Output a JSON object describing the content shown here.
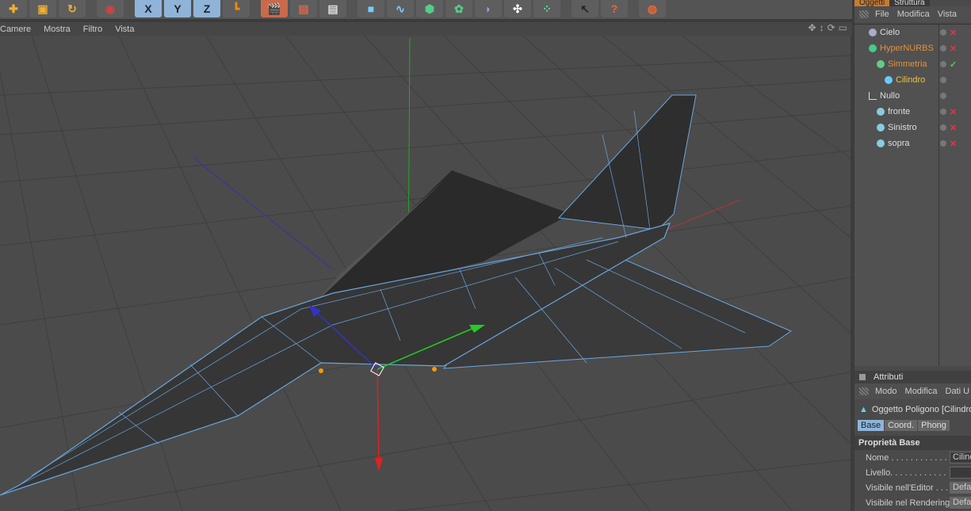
{
  "toolbar": {
    "buttons": [
      "move",
      "scale",
      "rotate",
      "live-select",
      "x-axis",
      "y-axis",
      "z-axis",
      "coord-system",
      "render-view",
      "render-picture-viewer",
      "edit-render-settings",
      "cube",
      "spline",
      "nurbs",
      "array",
      "deformer",
      "scene",
      "effector",
      "help",
      "web"
    ],
    "axis_labels": [
      "X",
      "Y",
      "Z"
    ]
  },
  "viewport": {
    "menu": [
      "Camere",
      "Mostra",
      "Filtro",
      "Vista"
    ]
  },
  "objects": {
    "tabs": [
      "Oggetti",
      "Struttura"
    ],
    "menu": [
      "File",
      "Modifica",
      "Vista"
    ],
    "items": [
      {
        "name": "Cielo",
        "color": "#dddddd",
        "icon": "sky-icon",
        "indent": 0,
        "flag": "x"
      },
      {
        "name": "HyperNURBS",
        "color": "#e0903a",
        "icon": "hypernurbs-icon",
        "indent": 0,
        "flag": "x"
      },
      {
        "name": "Simmetria",
        "color": "#e0903a",
        "icon": "symmetry-icon",
        "indent": 1,
        "flag": "check"
      },
      {
        "name": "Cilindro",
        "color": "#f0c040",
        "icon": "polygon-icon",
        "indent": 2,
        "flag": ""
      },
      {
        "name": "Nullo",
        "color": "#dddddd",
        "icon": "null-icon",
        "indent": 0,
        "flag": ""
      },
      {
        "name": "fronte",
        "color": "#dddddd",
        "icon": "plane-icon",
        "indent": 1,
        "flag": "x"
      },
      {
        "name": "Sinistro",
        "color": "#dddddd",
        "icon": "plane-icon",
        "indent": 1,
        "flag": "x"
      },
      {
        "name": "sopra",
        "color": "#dddddd",
        "icon": "plane-icon",
        "indent": 1,
        "flag": "x"
      }
    ]
  },
  "attributes": {
    "title": "Attributi",
    "menu": [
      "Modo",
      "Modifica",
      "Dati U"
    ],
    "object_label": "Oggetto Poligono [Cilindro]",
    "tabs": [
      "Base",
      "Coord.",
      "Phong"
    ],
    "section": "Proprietà Base",
    "props": [
      {
        "label": "Nome . . . . . . . . . . . .",
        "value": "Cilindro"
      },
      {
        "label": "Livello. . . . . . . . . . . .",
        "value": ""
      },
      {
        "label": "Visibile nell'Editor . . .",
        "value": "Default"
      },
      {
        "label": "Visibile nel Rendering",
        "value": "Default"
      }
    ]
  }
}
